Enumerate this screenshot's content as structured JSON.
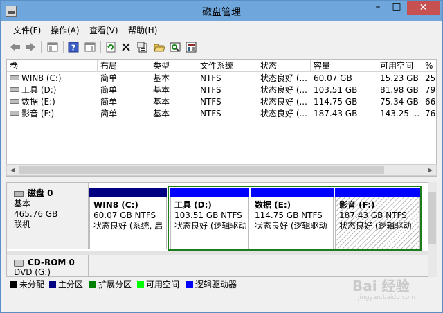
{
  "window": {
    "title": "磁盘管理",
    "min": "–",
    "max": "□",
    "close": "✕"
  },
  "menu": [
    "文件(F)",
    "操作(A)",
    "查看(V)",
    "帮助(H)"
  ],
  "toolbar_icons": [
    "back-arrow-icon",
    "forward-arrow-icon",
    "show-hide-console-icon",
    "help-icon",
    "properties-view-icon",
    "refresh-icon",
    "delete-icon",
    "properties-icon",
    "open-icon",
    "explore-icon",
    "settings-icon"
  ],
  "list": {
    "headers": [
      "卷",
      "布局",
      "类型",
      "文件系统",
      "状态",
      "容量",
      "可用空间",
      "%"
    ],
    "rows": [
      [
        "WIN8 (C:)",
        "简单",
        "基本",
        "NTFS",
        "状态良好 (...",
        "60.07 GB",
        "15.23 GB",
        "25"
      ],
      [
        "工具 (D:)",
        "简单",
        "基本",
        "NTFS",
        "状态良好 (...",
        "103.51 GB",
        "81.98 GB",
        "79"
      ],
      [
        "数据 (E:)",
        "简单",
        "基本",
        "NTFS",
        "状态良好 (...",
        "114.75 GB",
        "75.34 GB",
        "66"
      ],
      [
        "影音 (F:)",
        "简单",
        "基本",
        "NTFS",
        "状态良好 (...",
        "187.43 GB",
        "143.25 ...",
        "76"
      ]
    ]
  },
  "disk0": {
    "name": "磁盘 0",
    "type": "基本",
    "size": "465.76 GB",
    "state": "联机",
    "partitions": [
      {
        "name": "WIN8  (C:)",
        "size": "60.07 GB NTFS",
        "status": "状态良好 (系统, 启",
        "color": "#000080"
      },
      {
        "name": "工具  (D:)",
        "size": "103.51 GB NTFS",
        "status": "状态良好 (逻辑驱动",
        "color": "#0000ff"
      },
      {
        "name": "数据  (E:)",
        "size": "114.75 GB NTFS",
        "status": "状态良好 (逻辑驱动",
        "color": "#0000ff"
      },
      {
        "name": "影音  (F:)",
        "size": "187.43 GB NTFS",
        "status": "状态良好 (逻辑驱动",
        "color": "#0000ff"
      }
    ]
  },
  "cdrom": {
    "name": "CD-ROM 0",
    "drive": "DVD (G:)"
  },
  "legend": [
    {
      "label": "未分配",
      "color": "#000000"
    },
    {
      "label": "主分区",
      "color": "#000080"
    },
    {
      "label": "扩展分区",
      "color": "#008000"
    },
    {
      "label": "可用空间",
      "color": "#00ff00"
    },
    {
      "label": "逻辑驱动器",
      "color": "#0000ff"
    }
  ],
  "watermark": {
    "text": "Bai 经验",
    "sub": "jingyan.baidu.com"
  }
}
